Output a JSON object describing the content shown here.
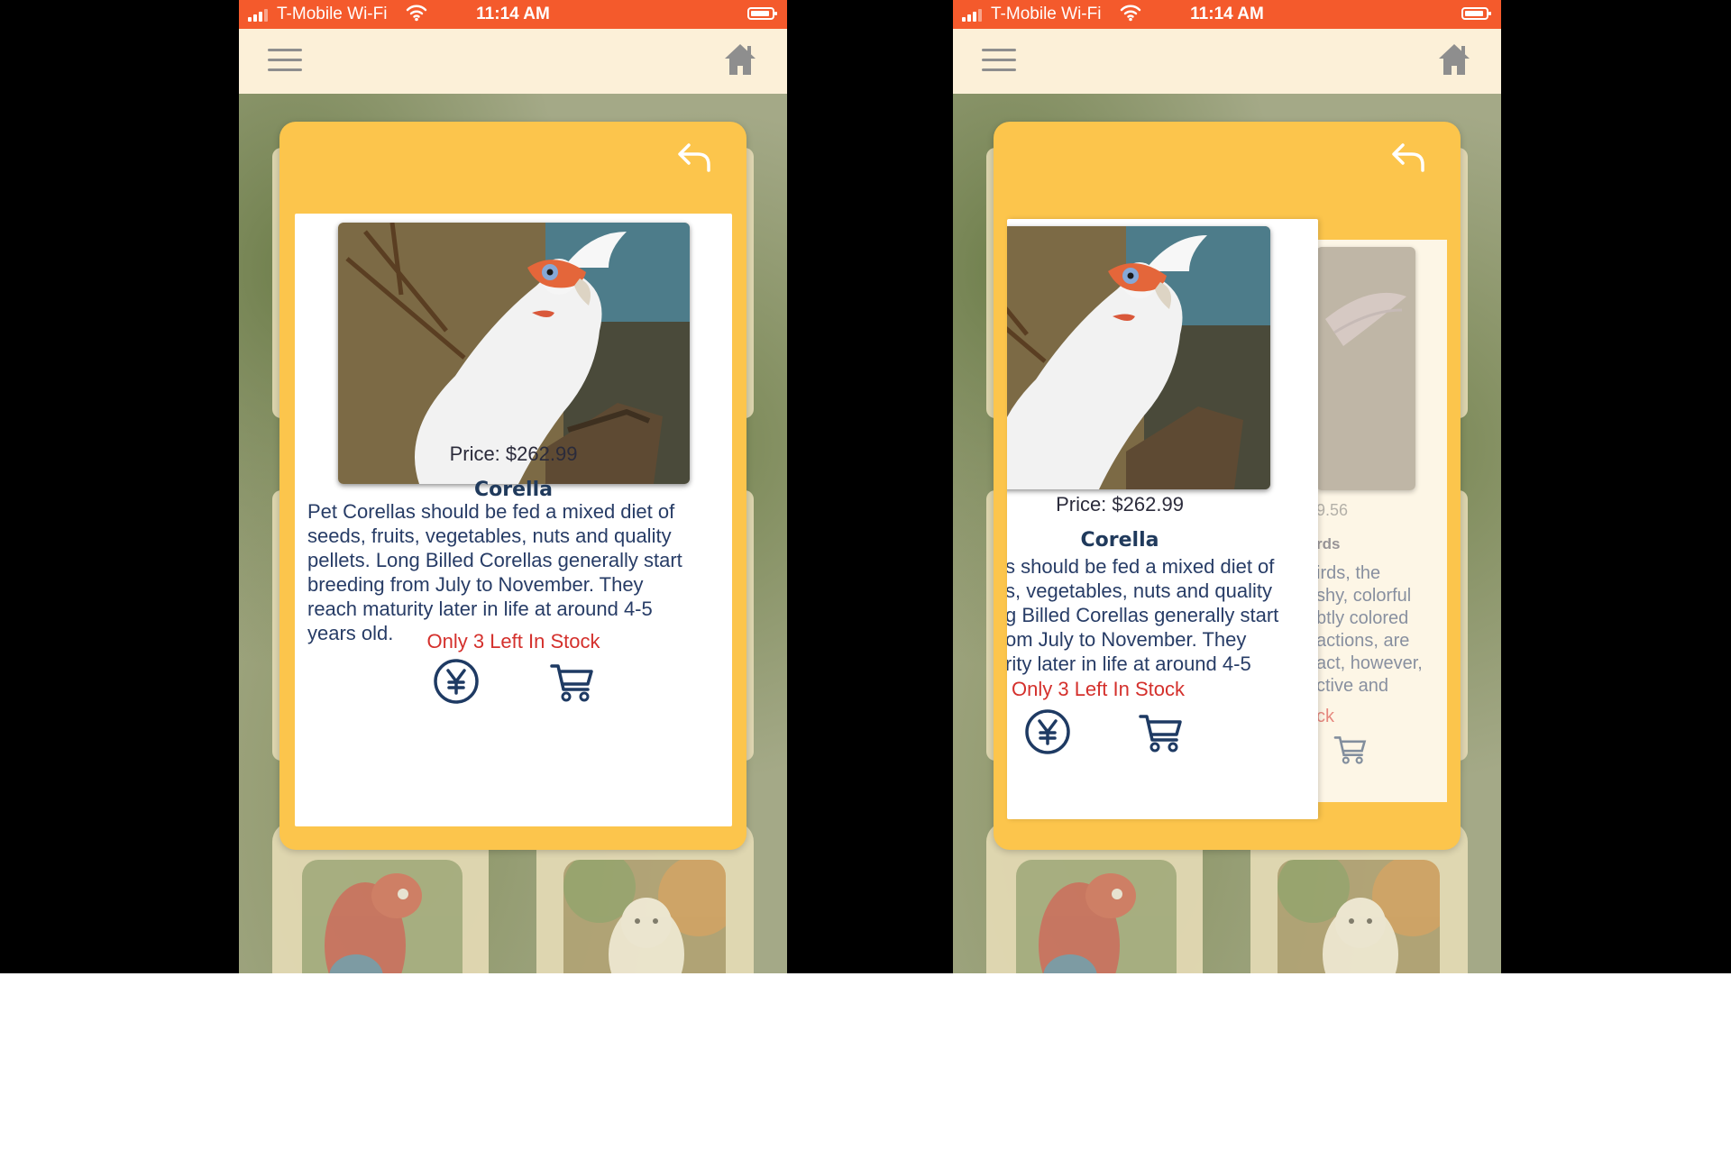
{
  "status_bar": {
    "carrier": "T-Mobile Wi-Fi",
    "time": "11:14 AM"
  },
  "product": {
    "price": "Price: $262.99",
    "name": "Corella",
    "description": "Pet Corellas should be fed a mixed diet of seeds, fruits, vegetables, nuts and quality pellets. Long Billed Corellas generally start breeding from July to November. They reach maturity later in life at around 4-5 years old.",
    "description_lines": [
      "Pet Corellas should be fed a mixed diet of",
      "seeds, fruits, vegetables, nuts and quality",
      "pellets. Long Billed Corellas generally start",
      "breeding from July to November. They",
      "reach maturity later in life at around 4-5",
      "years old."
    ],
    "stock": "Only 3 Left In Stock"
  },
  "right_card": {
    "price": "Price: $262.99",
    "name": "Corella",
    "description_lines": [
      "s should be fed a mixed diet of",
      "s, vegetables, nuts and quality",
      "g Billed Corellas generally start",
      "om July to November. They",
      "rity later in life at around 4-5"
    ],
    "stock": "Only 3 Left In Stock"
  },
  "next_card": {
    "price": "9.56",
    "name": "rds",
    "description_lines": [
      "irds, the",
      "shy, colorful",
      "btly colored",
      "actions, are",
      "act, however,",
      "ctive and"
    ],
    "stock": "ck"
  },
  "icons": {
    "menu": "hamburger-menu-icon",
    "home": "home-icon",
    "back": "back-arrow-icon",
    "price": "yen-coin-icon",
    "cart": "shopping-cart-icon"
  },
  "colors": {
    "status_bar": "#f45a2c",
    "nav_bar": "#fcf0d8",
    "modal": "#fcc54c",
    "icon_navy": "#1e3a63",
    "stock_red": "#d4302c"
  }
}
